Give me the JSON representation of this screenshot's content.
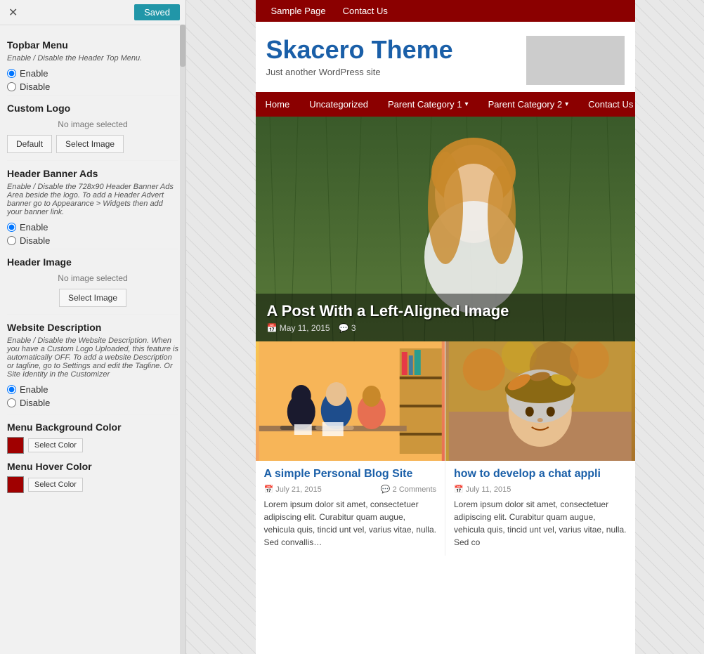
{
  "header": {
    "close_label": "✕",
    "saved_label": "Saved"
  },
  "left_panel": {
    "topbar_menu": {
      "title": "Topbar Menu",
      "description": "Enable / Disable the Header Top Menu.",
      "options": [
        "Enable",
        "Disable"
      ],
      "selected": "Enable"
    },
    "custom_logo": {
      "title": "Custom Logo",
      "no_image_text": "No image selected",
      "default_btn": "Default",
      "select_btn": "Select Image"
    },
    "header_banner_ads": {
      "title": "Header Banner Ads",
      "description": "Enable / Disable the 728x90 Header Banner Ads Area beside the logo. To add a Header Advert banner go to Appearance > Widgets then add your banner link.",
      "options": [
        "Enable",
        "Disable"
      ],
      "selected": "Enable"
    },
    "header_image": {
      "title": "Header Image",
      "no_image_text": "No image selected",
      "select_btn": "Select Image"
    },
    "website_description": {
      "title": "Website Description",
      "description": "Enable / Disable the Website Description. When you have a Custom Logo Uploaded, this feature is automatically OFF. To add a website Description or tagline, go to Settings and edit the Tagline. Or Site Identity in the Customizer",
      "options": [
        "Enable",
        "Disable"
      ],
      "selected": "Enable"
    },
    "menu_bg_color": {
      "title": "Menu Background Color",
      "select_label": "Select Color"
    },
    "menu_hover_color": {
      "title": "Menu Hover Color",
      "select_label": "Select Color"
    }
  },
  "site_preview": {
    "top_menu": {
      "items": [
        "Sample Page",
        "Contact Us"
      ]
    },
    "site_title": "Skacero Theme",
    "site_tagline": "Just another WordPress site",
    "nav": {
      "items": [
        {
          "label": "Home",
          "has_dropdown": false
        },
        {
          "label": "Uncategorized",
          "has_dropdown": false
        },
        {
          "label": "Parent Category 1",
          "has_dropdown": true
        },
        {
          "label": "Parent Category 2",
          "has_dropdown": true
        },
        {
          "label": "Contact Us",
          "has_dropdown": false
        }
      ]
    },
    "featured_post": {
      "title": "A Post With a Left-Aligned Image",
      "date": "May 11, 2015",
      "comments": "3"
    },
    "posts": [
      {
        "title": "A simple Personal Blog Site",
        "date": "July 21, 2015",
        "comments": "2 Comments",
        "excerpt": "Lorem ipsum dolor sit amet, consectetuer adipiscing elit. Curabitur quam augue, vehicula quis, tincid unt vel, varius vitae, nulla. Sed convallis…",
        "img_type": "study"
      },
      {
        "title": "how to develop a chat appli",
        "date": "July 11, 2015",
        "comments": "",
        "excerpt": "Lorem ipsum dolor sit amet, consectetuer adipiscing elit. Curabitur quam augue, vehicula quis, tincid unt vel, varius vitae, nulla. Sed co",
        "img_type": "autumn"
      }
    ]
  }
}
